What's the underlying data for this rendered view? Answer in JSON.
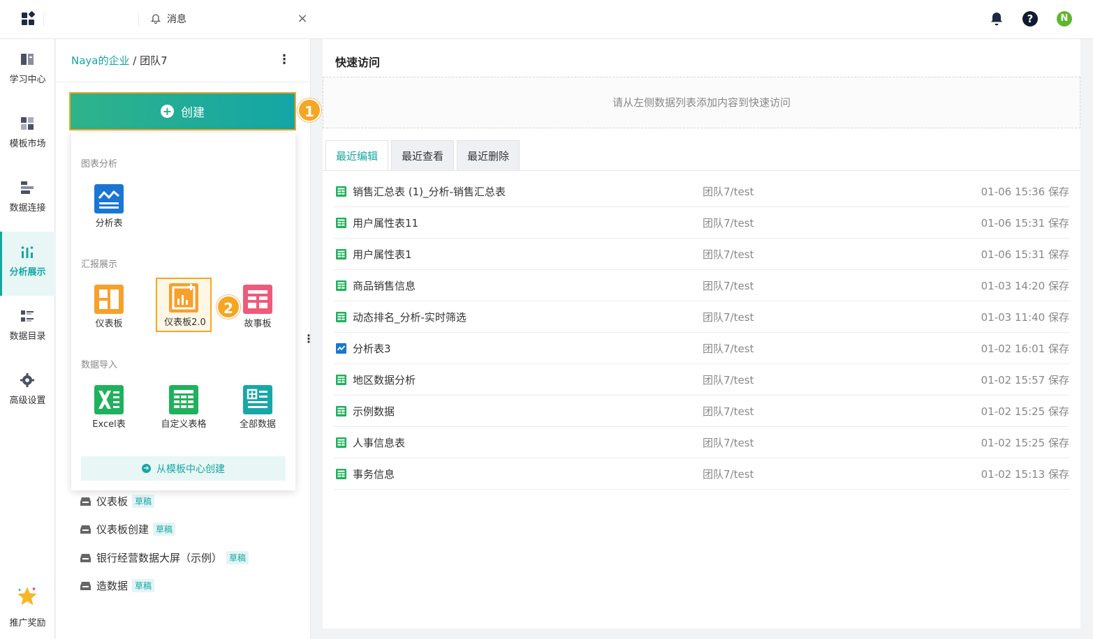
{
  "topbar": {
    "message_tab_label": "消息",
    "close_glyph": "×",
    "help_glyph": "?",
    "avatar_letter": "N"
  },
  "nav": {
    "items": [
      {
        "label": "学习中心",
        "icon": "book-icon"
      },
      {
        "label": "模板市场",
        "icon": "template-icon"
      },
      {
        "label": "数据连接",
        "icon": "database-icon"
      },
      {
        "label": "分析展示",
        "icon": "chart-icon",
        "active": true
      },
      {
        "label": "数据目录",
        "icon": "catalog-icon"
      },
      {
        "label": "高级设置",
        "icon": "gear-icon"
      }
    ],
    "promo_label": "推广奖励"
  },
  "breadcrumb": {
    "org": "Naya的企业",
    "sep": " / ",
    "team": "团队7"
  },
  "create": {
    "label": "创建",
    "step1": "1",
    "step2": "2"
  },
  "dropdown": {
    "section_chart": "图表分析",
    "section_report": "汇报展示",
    "section_import": "数据导入",
    "items": {
      "analysis_table": "分析表",
      "dashboard": "仪表板",
      "dashboard2": "仪表板2.0",
      "storyboard": "故事板",
      "excel": "Excel表",
      "custom_table": "自定义表格",
      "all_data": "全部数据"
    },
    "template_button": "从模板中心创建"
  },
  "drafts": [
    {
      "name": "仪表板",
      "tag": "草稿"
    },
    {
      "name": "仪表板创建",
      "tag": "草稿"
    },
    {
      "name": "银行经营数据大屏（示例）",
      "tag": "草稿"
    },
    {
      "name": "造数据",
      "tag": "草稿"
    }
  ],
  "quick_access": {
    "title": "快速访问",
    "empty_hint": "请从左侧数据列表添加内容到快速访问"
  },
  "tabs": [
    "最近编辑",
    "最近查看",
    "最近删除"
  ],
  "recent": [
    {
      "name": "销售汇总表 (1)_分析-销售汇总表",
      "path": "团队7/test",
      "time": "01-06 15:36 保存",
      "type": "table"
    },
    {
      "name": "用户属性表11",
      "path": "团队7/test",
      "time": "01-06 15:31 保存",
      "type": "table"
    },
    {
      "name": "用户属性表1",
      "path": "团队7/test",
      "time": "01-06 15:31 保存",
      "type": "table"
    },
    {
      "name": "商品销售信息",
      "path": "团队7/test",
      "time": "01-03 14:20 保存",
      "type": "table"
    },
    {
      "name": "动态排名_分析-实时筛选",
      "path": "团队7/test",
      "time": "01-03 11:40 保存",
      "type": "table"
    },
    {
      "name": "分析表3",
      "path": "团队7/test",
      "time": "01-02 16:01 保存",
      "type": "analysis"
    },
    {
      "name": "地区数据分析",
      "path": "团队7/test",
      "time": "01-02 15:57 保存",
      "type": "table"
    },
    {
      "name": "示例数据",
      "path": "团队7/test",
      "time": "01-02 15:25 保存",
      "type": "table"
    },
    {
      "name": "人事信息表",
      "path": "团队7/test",
      "time": "01-02 15:25 保存",
      "type": "table"
    },
    {
      "name": "事务信息",
      "path": "团队7/test",
      "time": "01-02 15:13 保存",
      "type": "table"
    }
  ],
  "colors": {
    "accent": "#15a7a2",
    "highlight": "#f5a623",
    "excel_green": "#1fb15b",
    "orange": "#f7a02b",
    "pink": "#ef5a7a",
    "blue": "#1976d2"
  }
}
